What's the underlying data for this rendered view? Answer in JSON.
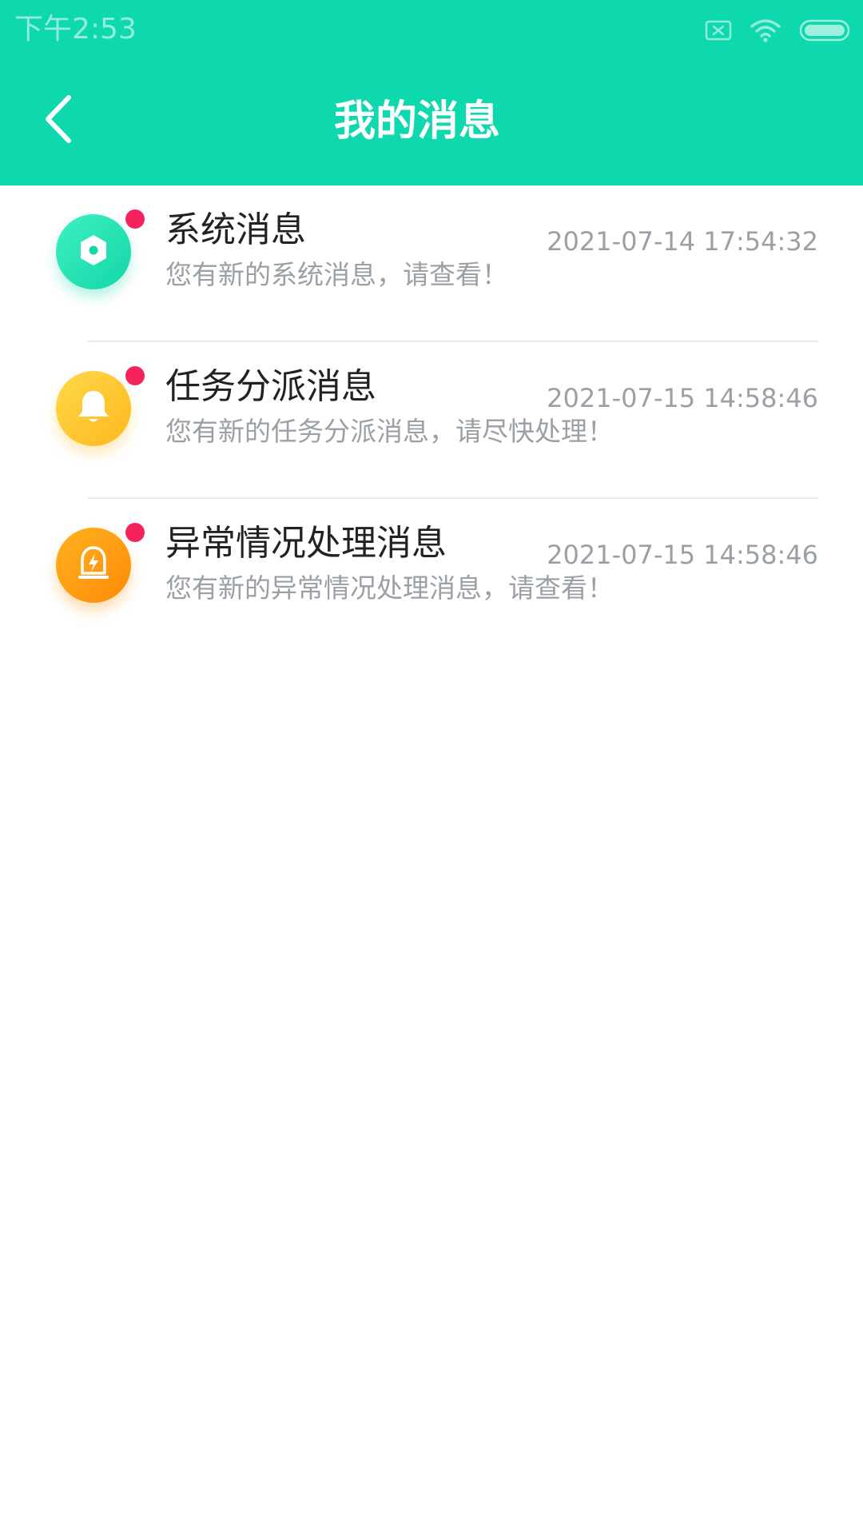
{
  "status_bar": {
    "time": "下午2:53",
    "icons": [
      "sim-x-icon",
      "wifi-icon",
      "battery-icon"
    ]
  },
  "header": {
    "title": "我的消息",
    "back_icon": "chevron-left-icon",
    "background_color": "#0ed8ad"
  },
  "messages": [
    {
      "title": "系统消息",
      "subtitle": "您有新的系统消息，请查看！",
      "time": "2021-07-14 17:54:32",
      "icon": "hexagon-nut-icon",
      "icon_color": "#14d6a6",
      "unread": true
    },
    {
      "title": "任务分派消息",
      "subtitle": "您有新的任务分派消息，请尽快处理！",
      "time": "2021-07-15 14:58:46",
      "icon": "bell-icon",
      "icon_color": "#fdb81d",
      "unread": true
    },
    {
      "title": "异常情况处理消息",
      "subtitle": "您有新的异常情况处理消息，请查看！",
      "time": "2021-07-15 14:58:46",
      "icon": "alarm-light-icon",
      "icon_color": "#ff8a08",
      "unread": true
    }
  ],
  "colors": {
    "unread_dot": "#f5225e",
    "title_text": "#222222",
    "secondary_text": "#9aa0a6"
  }
}
